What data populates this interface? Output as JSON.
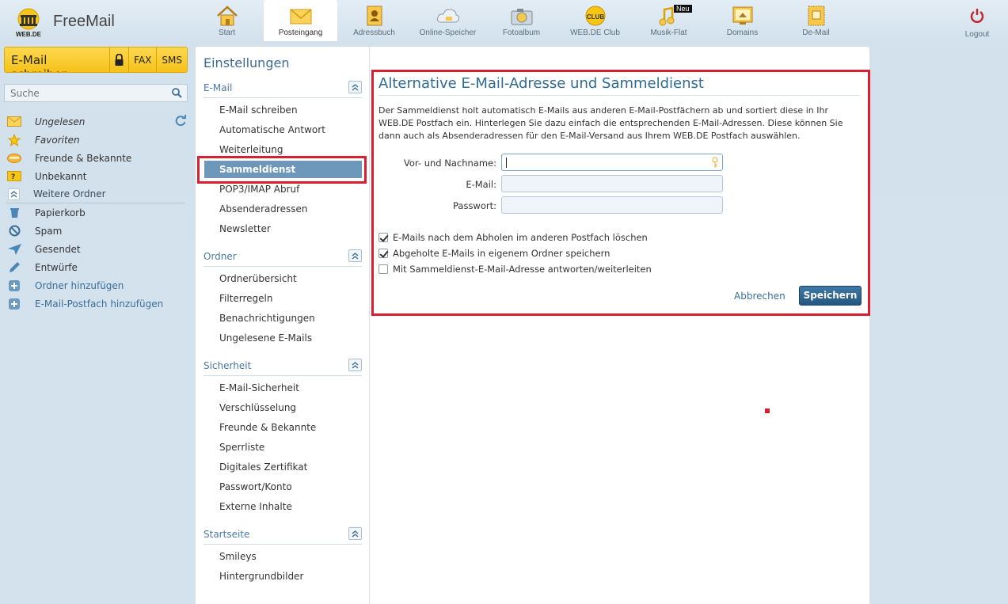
{
  "brand": {
    "logo_label": "WEB.DE",
    "product": "FreeMail"
  },
  "topnav": [
    {
      "id": "start",
      "label": "Start",
      "icon": "house-icon"
    },
    {
      "id": "inbox",
      "label": "Posteingang",
      "icon": "envelope-icon",
      "active": true
    },
    {
      "id": "contacts",
      "label": "Adressbuch",
      "icon": "addressbook-icon"
    },
    {
      "id": "storage",
      "label": "Online-Speicher",
      "icon": "cloud-icon"
    },
    {
      "id": "photo",
      "label": "Fotoalbum",
      "icon": "camera-icon"
    },
    {
      "id": "club",
      "label": "WEB.DE Club",
      "icon": "club-icon"
    },
    {
      "id": "music",
      "label": "Musik-Flat",
      "icon": "music-icon",
      "badge": "Neu"
    },
    {
      "id": "domains",
      "label": "Domains",
      "icon": "domain-icon"
    },
    {
      "id": "demail",
      "label": "De-Mail",
      "icon": "demail-icon"
    }
  ],
  "logout_label": "Logout",
  "compose": {
    "label": "E-Mail schreiben",
    "fax": "FAX",
    "sms": "SMS"
  },
  "search": {
    "placeholder": "Suche"
  },
  "folders": [
    {
      "label": "Ungelesen",
      "icon": "envelope-icon",
      "style": "italic"
    },
    {
      "label": "Favoriten",
      "icon": "star-icon",
      "style": "italic"
    },
    {
      "label": "Freunde & Bekannte",
      "icon": "friends-icon",
      "style": ""
    },
    {
      "label": "Unbekannt",
      "icon": "unknown-icon",
      "style": ""
    },
    {
      "label": "Weitere Ordner",
      "icon": "chevrons-up-icon",
      "style": "sub"
    },
    {
      "label": "Papierkorb",
      "icon": "trash-icon",
      "style": ""
    },
    {
      "label": "Spam",
      "icon": "block-icon",
      "style": ""
    },
    {
      "label": "Gesendet",
      "icon": "send-icon",
      "style": ""
    },
    {
      "label": "Entwürfe",
      "icon": "pencil-icon",
      "style": ""
    },
    {
      "label": "Ordner hinzufügen",
      "icon": "plus-icon",
      "style": "blue"
    },
    {
      "label": "E-Mail-Postfach hinzufügen",
      "icon": "plus-icon",
      "style": "blue"
    }
  ],
  "settings": {
    "title": "Einstellungen",
    "sections": [
      {
        "title": "E-Mail",
        "items": [
          "E-Mail schreiben",
          "Automatische Antwort",
          "Weiterleitung",
          "Sammeldienst",
          "POP3/IMAP Abruf",
          "Absenderadressen",
          "Newsletter"
        ],
        "active": "Sammeldienst"
      },
      {
        "title": "Ordner",
        "items": [
          "Ordnerübersicht",
          "Filterregeln",
          "Benachrichtigungen",
          "Ungelesene E-Mails"
        ]
      },
      {
        "title": "Sicherheit",
        "items": [
          "E-Mail-Sicherheit",
          "Verschlüsselung",
          "Freunde & Bekannte",
          "Sperrliste",
          "Digitales Zertifikat",
          "Passwort/Konto",
          "Externe Inhalte"
        ]
      },
      {
        "title": "Startseite",
        "items": [
          "Smileys",
          "Hintergrundbilder"
        ]
      }
    ]
  },
  "form": {
    "title": "Alternative E-Mail-Adresse und Sammeldienst",
    "description": "Der Sammeldienst holt automatisch E-Mails aus anderen E-Mail-Postfächern ab und sortiert diese in Ihr WEB.DE Postfach ein. Hinterlegen Sie dazu einfach die entsprechenden E-Mail-Adressen. Diese können Sie dann auch als Absenderadressen für den E-Mail-Versand aus Ihrem WEB.DE Postfach auswählen.",
    "fields": [
      {
        "label": "Vor- und Nachname:",
        "value": ""
      },
      {
        "label": "E-Mail:",
        "value": ""
      },
      {
        "label": "Passwort:",
        "value": ""
      }
    ],
    "checkboxes": [
      {
        "label": "E-Mails nach dem Abholen im anderen Postfach löschen",
        "checked": true
      },
      {
        "label": "Abgeholte E-Mails in eigenem Ordner speichern",
        "checked": true
      },
      {
        "label": "Mit Sammeldienst-E-Mail-Adresse antworten/weiterleiten",
        "checked": false
      }
    ],
    "cancel_label": "Abbrechen",
    "save_label": "Speichern"
  },
  "colors": {
    "accent": "#2f6b93",
    "highlight": "#d9202e",
    "compose": "#f5c21a",
    "active_item": "#6d97bb"
  }
}
